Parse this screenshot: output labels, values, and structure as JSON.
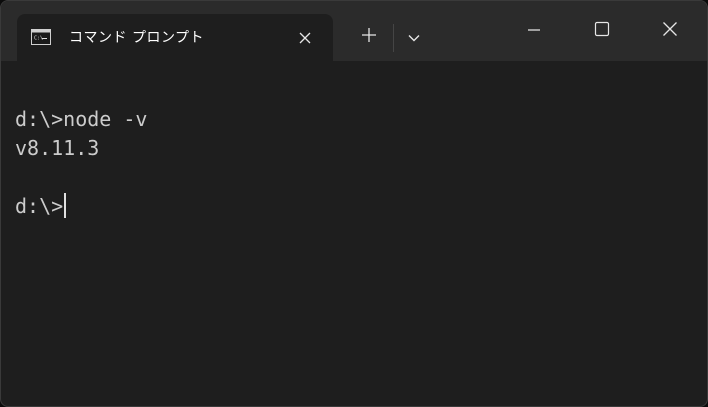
{
  "tab": {
    "icon": "command-prompt-icon",
    "title": "コマンド プロンプト",
    "close_icon": "close-icon"
  },
  "toolbar": {
    "new_tab_icon": "plus-icon",
    "dropdown_icon": "chevron-down-icon"
  },
  "window_controls": {
    "minimize_icon": "minimize-icon",
    "maximize_icon": "maximize-icon",
    "close_icon": "close-icon"
  },
  "terminal": {
    "lines": [
      "d:\\>node -v",
      "v8.11.3",
      "",
      "d:\\>"
    ]
  },
  "colors": {
    "background": "#1e1e1e",
    "titlebar": "#2b2b2b",
    "text": "#cccccc"
  }
}
